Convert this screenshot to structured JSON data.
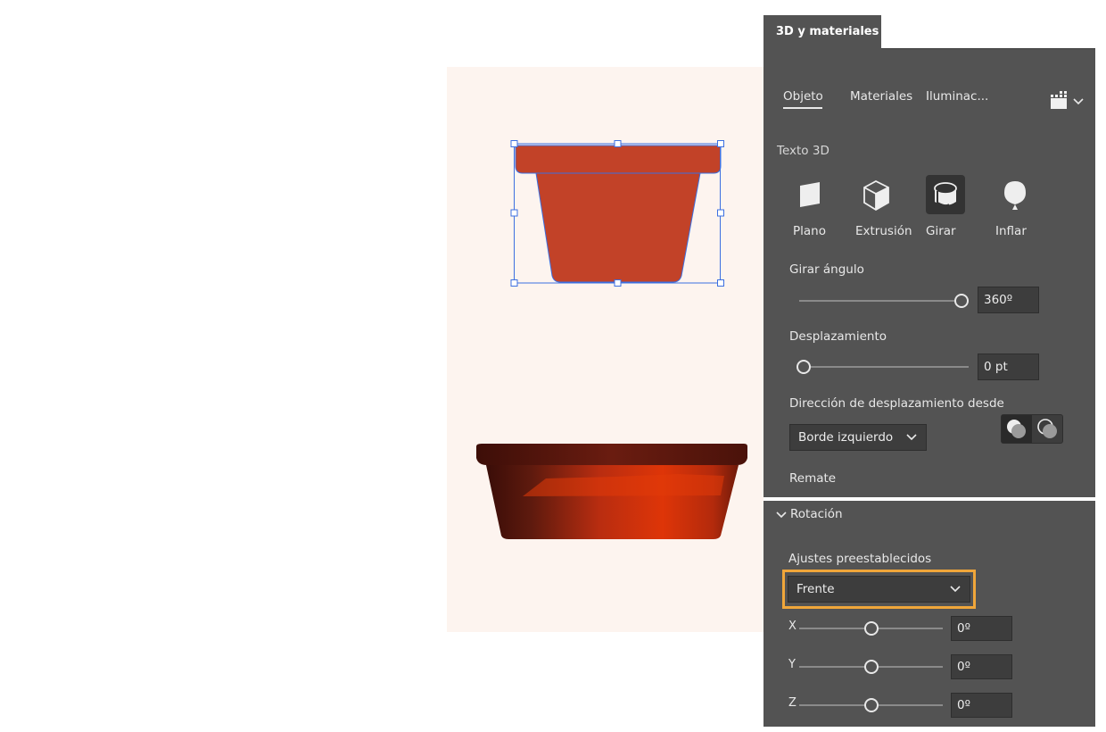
{
  "panel": {
    "title": "3D y materiales",
    "tabs": [
      {
        "label": "Objeto",
        "active": true
      },
      {
        "label": "Materiales",
        "active": false
      },
      {
        "label": "Iluminac...",
        "active": false
      }
    ],
    "render_icon": "render-quality-icon"
  },
  "object_section": {
    "heading": "Texto 3D",
    "types": [
      {
        "label": "Plano",
        "icon": "plane-icon"
      },
      {
        "label": "Extrusión",
        "icon": "extrude-cube-icon"
      },
      {
        "label": "Girar",
        "icon": "revolve-icon",
        "selected": true
      },
      {
        "label": "Inflar",
        "icon": "inflate-balloon-icon"
      }
    ],
    "revolve_angle": {
      "label": "Girar ángulo",
      "value": "360º",
      "level": 1.0
    },
    "offset": {
      "label": "Desplazamiento",
      "value": "0 pt",
      "level": 0.0
    },
    "offset_direction": {
      "label": "Dirección de desplazamiento desde",
      "value": "Borde izquierdo"
    },
    "cap": {
      "label": "Remate",
      "options": [
        "cap-on-icon",
        "cap-off-icon"
      ],
      "selected": 0
    }
  },
  "rotation_section": {
    "heading": "Rotación",
    "presets_label": "Ajustes preestablecidos",
    "preset_value": "Frente",
    "axes": [
      {
        "label": "X",
        "value": "0º",
        "level": 0.5
      },
      {
        "label": "Y",
        "value": "0º",
        "level": 0.5
      },
      {
        "label": "Z",
        "value": "0º",
        "level": 0.5
      }
    ]
  },
  "colors": {
    "pot_flat": "#c24228",
    "panel_bg": "#535353",
    "selection": "#3c6fe0",
    "highlight": "#f0a63a",
    "artboard": "#fdf4ef"
  }
}
